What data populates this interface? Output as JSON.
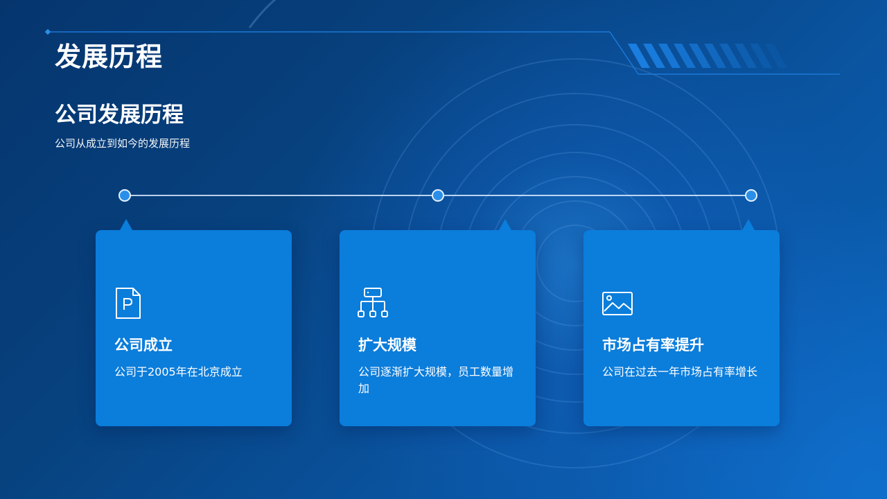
{
  "page": {
    "title": "发展历程"
  },
  "section": {
    "title": "公司发展历程",
    "subtitle": "公司从成立到如今的发展历程"
  },
  "colors": {
    "background_dark": "#06356e",
    "background_light": "#0a63b8",
    "card": "#0b7ddb",
    "timeline_dot": "#2a8fe8",
    "text": "#ffffff"
  },
  "milestones": [
    {
      "icon": "document-p-icon",
      "title": "公司成立",
      "description": "公司于2005年在北京成立"
    },
    {
      "icon": "org-chart-icon",
      "title": "扩大规模",
      "description": "公司逐渐扩大规模，员工数量增加"
    },
    {
      "icon": "image-icon",
      "title": "市场占有率提升",
      "description": "公司在过去一年市场占有率增长"
    }
  ]
}
